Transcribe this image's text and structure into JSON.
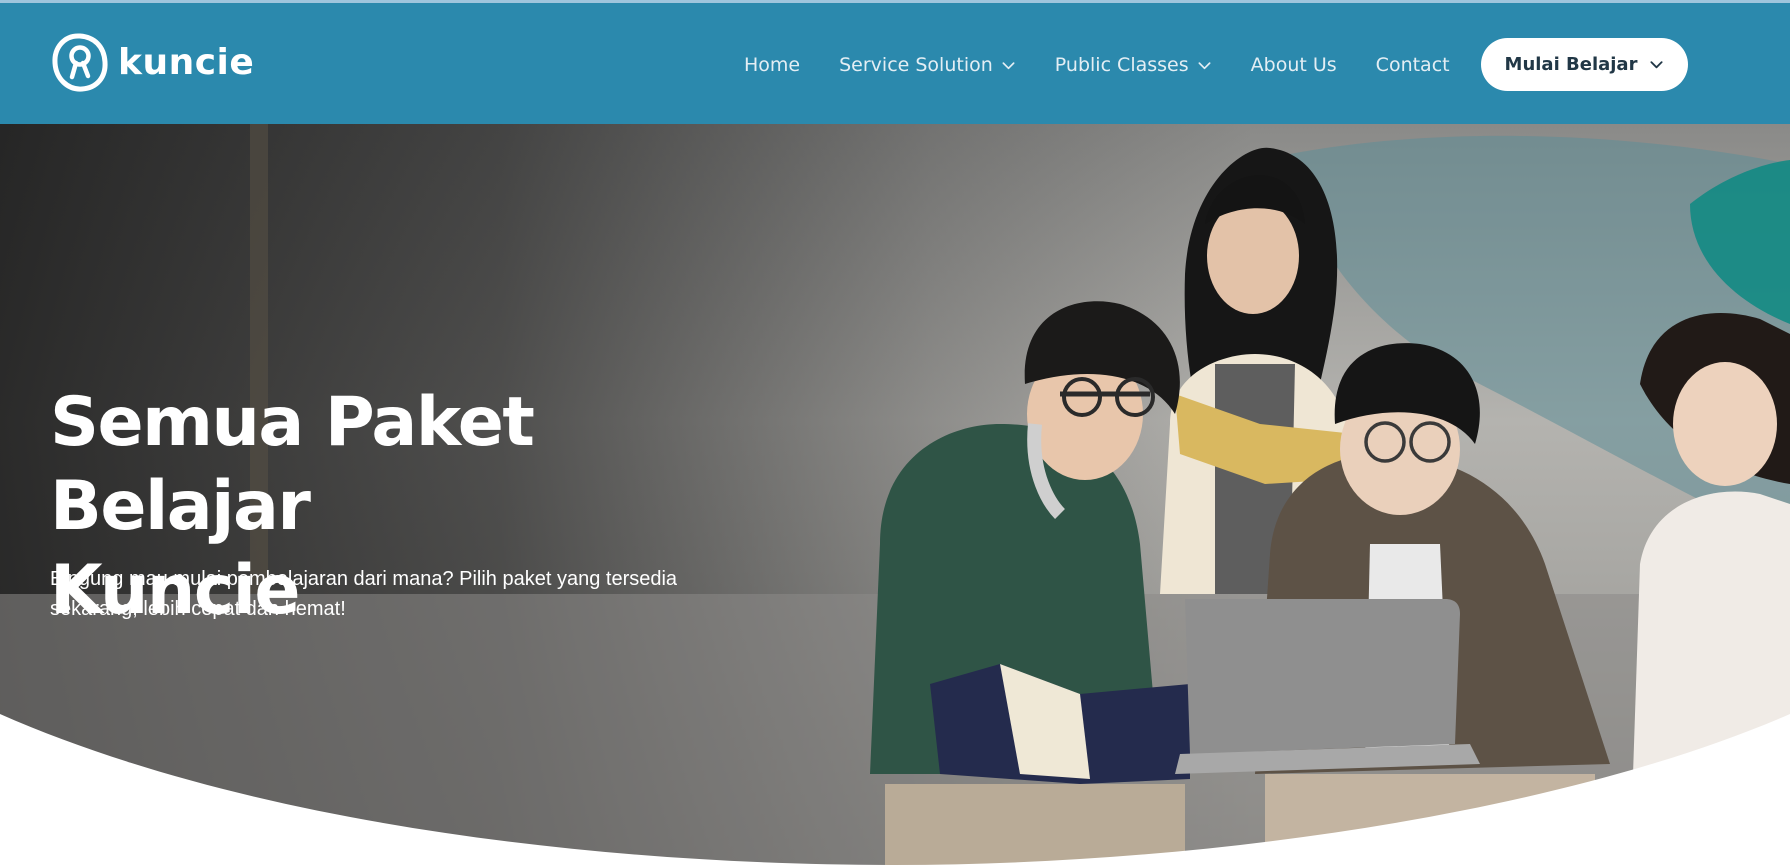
{
  "brand": {
    "name": "kuncie",
    "header_color": "#2b89ad",
    "logo_icon": "key-circle-logo-icon"
  },
  "nav": {
    "items": [
      {
        "label": "Home",
        "has_dropdown": false
      },
      {
        "label": "Service Solution",
        "has_dropdown": true
      },
      {
        "label": "Public Classes",
        "has_dropdown": true
      },
      {
        "label": "About Us",
        "has_dropdown": false
      },
      {
        "label": "Contact",
        "has_dropdown": false
      }
    ],
    "cta_label": "Mulai Belajar",
    "cta_icon": "chevron-down-icon"
  },
  "hero": {
    "title_line1": "Semua Paket Belajar",
    "title_line2": "Kuncie",
    "subtitle_line1": "Bingung mau mulai pembelajaran dari mana? Pilih paket yang tersedia",
    "subtitle_line2": "sekarang, lebih cepat dan hemat!",
    "image_subject": "four students studying with books and a laptop"
  }
}
